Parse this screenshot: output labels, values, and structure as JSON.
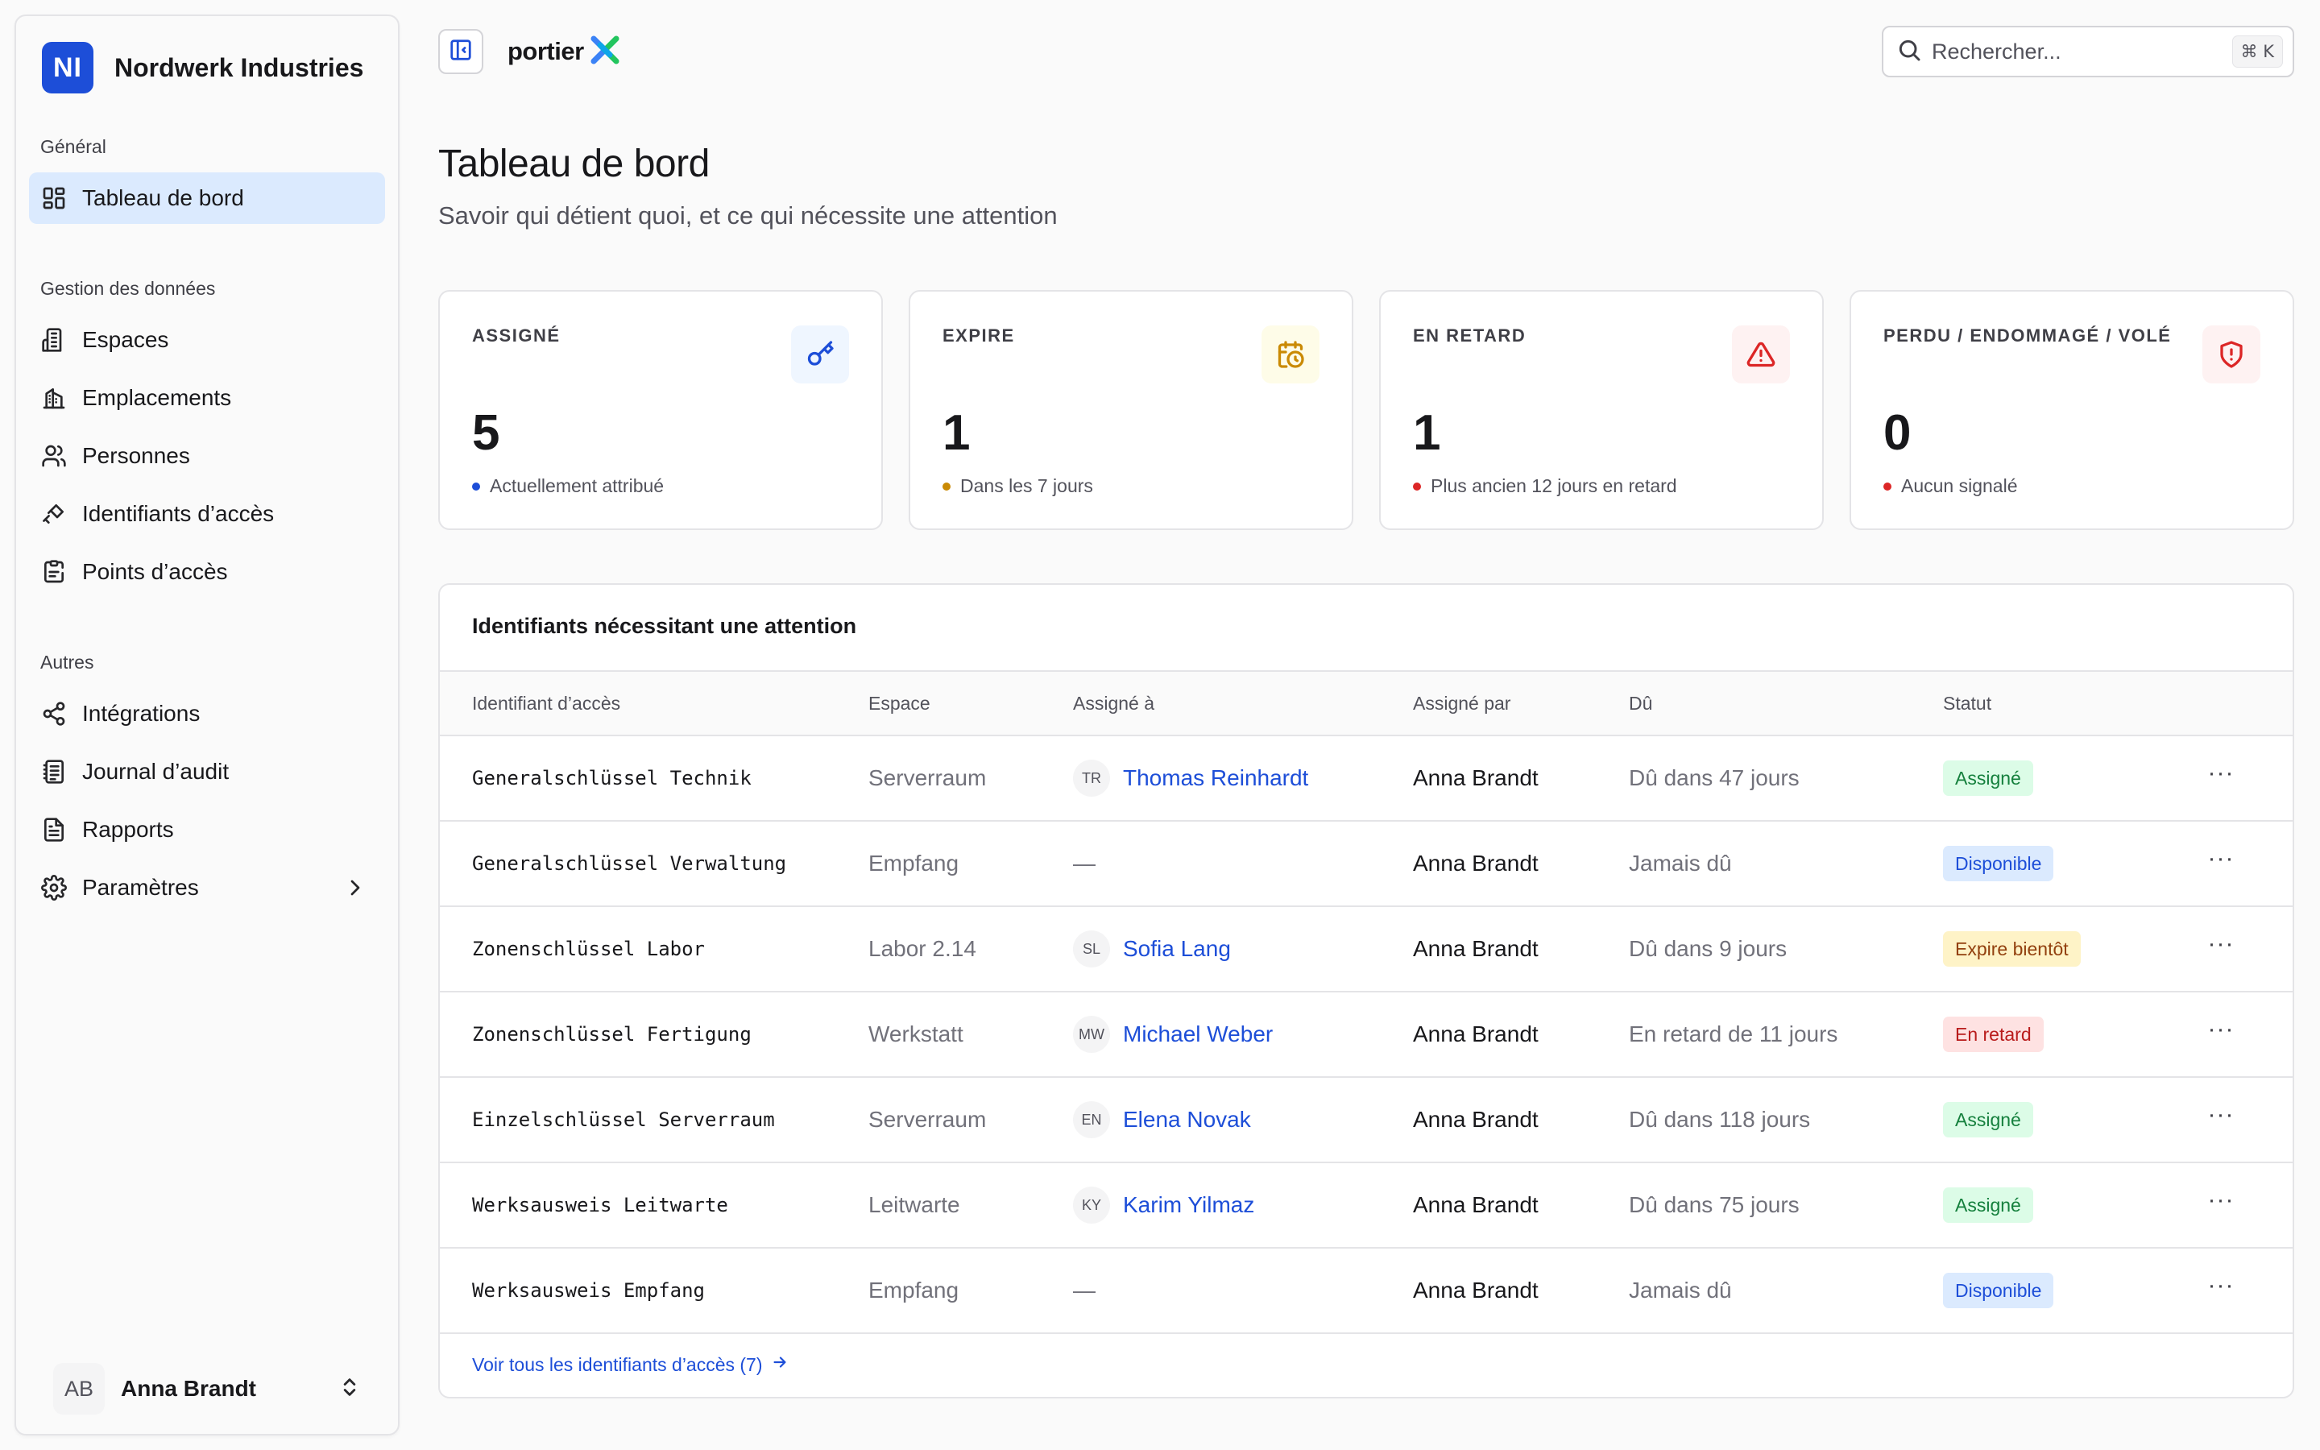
{
  "org": {
    "initials": "NI",
    "name": "Nordwerk Industries"
  },
  "sidebar": {
    "groups": [
      {
        "label": "Général",
        "items": [
          {
            "label": "Tableau de bord",
            "icon": "dashboard-icon",
            "active": true
          }
        ]
      },
      {
        "label": "Gestion des données",
        "items": [
          {
            "label": "Espaces",
            "icon": "building-icon"
          },
          {
            "label": "Emplacements",
            "icon": "buildings-icon"
          },
          {
            "label": "Personnes",
            "icon": "users-icon"
          },
          {
            "label": "Identifiants d’accès",
            "icon": "key-icon"
          },
          {
            "label": "Points d’accès",
            "icon": "door-icon"
          }
        ]
      },
      {
        "label": "Autres",
        "items": [
          {
            "label": "Intégrations",
            "icon": "share-icon"
          },
          {
            "label": "Journal d’audit",
            "icon": "log-icon"
          },
          {
            "label": "Rapports",
            "icon": "report-icon"
          },
          {
            "label": "Paramètres",
            "icon": "gear-icon"
          }
        ]
      }
    ]
  },
  "user": {
    "initials": "AB",
    "name": "Anna Brandt"
  },
  "topbar": {
    "brand": "portier",
    "search_placeholder": "Rechercher...",
    "search_shortcut": "⌘ K"
  },
  "page": {
    "title": "Tableau de bord",
    "subtitle": "Savoir qui détient quoi, et ce qui nécessite une attention"
  },
  "stats": [
    {
      "label": "ASSIGNÉ",
      "value": "5",
      "note": "Actuellement attribué",
      "icon": "key-icon",
      "accent": "#1d4ed8",
      "tint": "#eff6ff"
    },
    {
      "label": "EXPIRE",
      "value": "1",
      "note": "Dans les 7 jours",
      "icon": "calendar-clock-icon",
      "accent": "#ca8a04",
      "tint": "#fefce8"
    },
    {
      "label": "EN RETARD",
      "value": "1",
      "note": "Plus ancien 12 jours en retard",
      "icon": "alert-triangle-icon",
      "accent": "#dc2626",
      "tint": "#fef2f2"
    },
    {
      "label": "PERDU / ENDOMMAGÉ / VOLÉ",
      "value": "0",
      "note": "Aucun signalé",
      "icon": "shield-alert-icon",
      "accent": "#dc2626",
      "tint": "#fef2f2"
    }
  ],
  "attention": {
    "title": "Identifiants nécessitant une attention",
    "columns": [
      "Identifiant d’accès",
      "Espace",
      "Assigné à",
      "Assigné par",
      "Dû",
      "Statut"
    ],
    "rows": [
      {
        "credential": "Generalschlüssel Technik",
        "space": "Serverraum",
        "initials": "TR",
        "assignee": "Thomas Reinhardt",
        "by": "Anna Brandt",
        "due": "Dû dans 47 jours",
        "status": "Assigné",
        "status_kind": "assigned"
      },
      {
        "credential": "Generalschlüssel Verwaltung",
        "space": "Empfang",
        "initials": "",
        "assignee": "—",
        "by": "Anna Brandt",
        "due": "Jamais dû",
        "status": "Disponible",
        "status_kind": "available"
      },
      {
        "credential": "Zonenschlüssel Labor",
        "space": "Labor 2.14",
        "initials": "SL",
        "assignee": "Sofia Lang",
        "by": "Anna Brandt",
        "due": "Dû dans 9 jours",
        "status": "Expire bientôt",
        "status_kind": "expiring"
      },
      {
        "credential": "Zonenschlüssel Fertigung",
        "space": "Werkstatt",
        "initials": "MW",
        "assignee": "Michael Weber",
        "by": "Anna Brandt",
        "due": "En retard de 11 jours",
        "status": "En retard",
        "status_kind": "overdue"
      },
      {
        "credential": "Einzelschlüssel Serverraum",
        "space": "Serverraum",
        "initials": "EN",
        "assignee": "Elena Novak",
        "by": "Anna Brandt",
        "due": "Dû dans 118 jours",
        "status": "Assigné",
        "status_kind": "assigned"
      },
      {
        "credential": "Werksausweis Leitwarte",
        "space": "Leitwarte",
        "initials": "KY",
        "assignee": "Karim Yilmaz",
        "by": "Anna Brandt",
        "due": "Dû dans 75 jours",
        "status": "Assigné",
        "status_kind": "assigned"
      },
      {
        "credential": "Werksausweis Empfang",
        "space": "Empfang",
        "initials": "",
        "assignee": "—",
        "by": "Anna Brandt",
        "due": "Jamais dû",
        "status": "Disponible",
        "status_kind": "available"
      }
    ],
    "row_action": "···",
    "view_all": "Voir tous les identifiants d’accès (7)"
  }
}
